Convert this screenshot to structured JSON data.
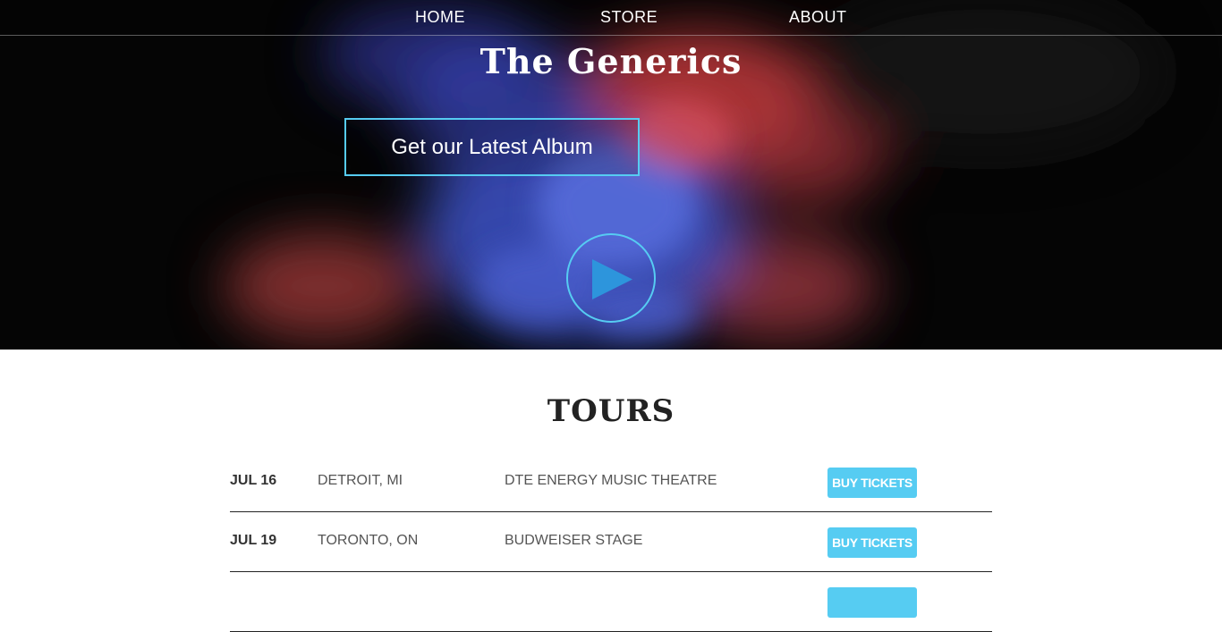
{
  "nav": {
    "items": [
      {
        "label": "HOME"
      },
      {
        "label": "STORE"
      },
      {
        "label": "ABOUT"
      }
    ]
  },
  "hero": {
    "title": "The Generics",
    "album_button": "Get our Latest Album",
    "play_icon": "play-icon"
  },
  "tours": {
    "title": "TOURS",
    "rows": [
      {
        "date": "JUL 16",
        "city": "DETROIT, MI",
        "venue": "DTE ENERGY MUSIC THEATRE",
        "button": "BUY TICKETS"
      },
      {
        "date": "JUL 19",
        "city": "TORONTO, ON",
        "venue": "BUDWEISER STAGE",
        "button": "BUY TICKETS"
      },
      {
        "date": "",
        "city": "",
        "venue": "",
        "button": ""
      }
    ]
  },
  "colors": {
    "accent": "#56ccf2",
    "hero_background": "#050505"
  }
}
